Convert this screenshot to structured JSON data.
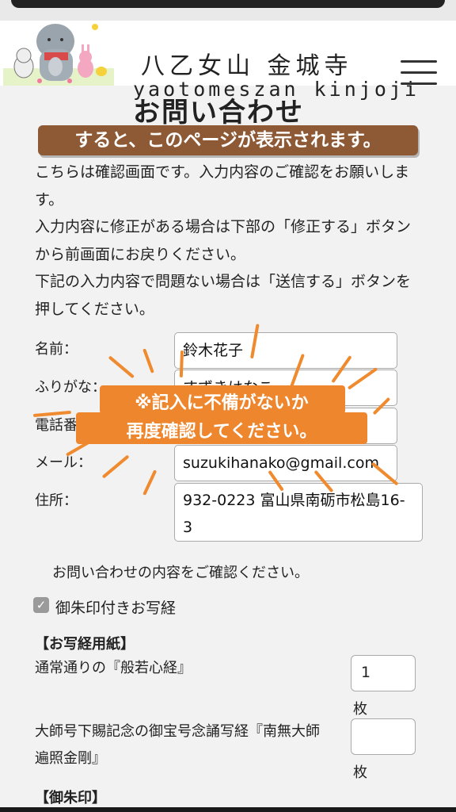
{
  "header": {
    "site_title_jp": "八乙女山 金城寺",
    "site_title_en": "yaotomeszan kinjoji",
    "menu_icon": "hamburger-menu-icon"
  },
  "page": {
    "title": "お問い合わせ",
    "banner": "すると、このページが表示されます。",
    "intro": [
      "こちらは確認画面です。入力内容のご確認をお願いします。",
      "入力内容に修正がある場合は下部の「修正する」ボタンから前画面にお戻りください。",
      "下記の入力内容で問題ない場合は「送信する」ボタンを押してください。"
    ]
  },
  "form": {
    "name": {
      "label": "名前：",
      "value": "鈴木花子"
    },
    "furigana": {
      "label": "ふりがな：",
      "value": "すずきはなこ"
    },
    "phone": {
      "label": "電話番号：",
      "value": ""
    },
    "email": {
      "label": "メール：",
      "value": "suzukihanako@gmail.com"
    },
    "address": {
      "label": "住所：",
      "value": "932-0223 富山県南砺市松島16-3"
    }
  },
  "callout": {
    "line1": "※記入に不備がないか",
    "line2": "再度確認してください。",
    "color": "#ee862e"
  },
  "confirm_note": "お問い合わせの内容をご確認ください。",
  "option": {
    "label": "御朱印付きお写経",
    "checked": true
  },
  "sutra_paper": {
    "heading": "【お写経用紙】",
    "items": [
      {
        "label": "通常通りの『般若心経』",
        "qty": "1",
        "unit": "枚"
      },
      {
        "label": "大師号下賜記念の御宝号念誦写経『南無大師遍照金剛』",
        "qty": "",
        "unit": "枚"
      }
    ]
  },
  "goshuin": {
    "heading": "【御朱印】"
  },
  "colors": {
    "banner": "#8e5a36",
    "accent": "#ee862e",
    "background": "#f2f2f2"
  }
}
